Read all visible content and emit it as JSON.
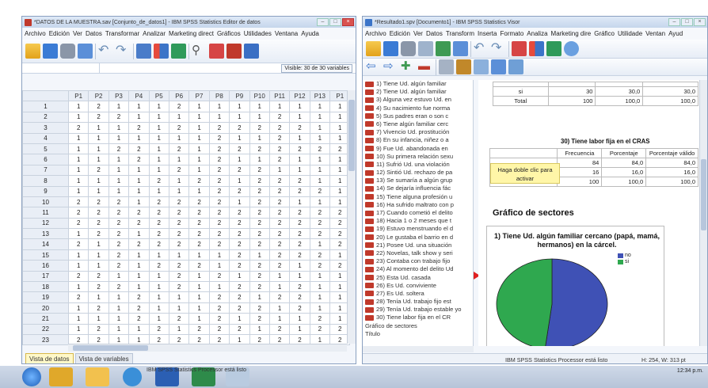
{
  "left_window": {
    "title": "*DATOS DE LA MUESTRA.sav [Conjunto_de_datos1] - IBM SPSS Statistics Editor de datos",
    "menu": [
      "Archivo",
      "Edición",
      "Ver",
      "Datos",
      "Transformar",
      "Analizar",
      "Marketing direct",
      "Gráficos",
      "Utilidades",
      "Ventana",
      "Ayuda"
    ],
    "visible_label": "Visible: 30 de 30 variables",
    "columns": [
      "P1",
      "P2",
      "P3",
      "P4",
      "P5",
      "P6",
      "P7",
      "P8",
      "P9",
      "P10",
      "P11",
      "P12",
      "P13",
      "P1"
    ],
    "rows": [
      [
        "1",
        "2",
        "1",
        "1",
        "1",
        "2",
        "1",
        "1",
        "1",
        "1",
        "1",
        "1",
        "1",
        "1"
      ],
      [
        "1",
        "2",
        "2",
        "1",
        "1",
        "1",
        "1",
        "1",
        "1",
        "1",
        "2",
        "1",
        "1",
        "1"
      ],
      [
        "2",
        "1",
        "1",
        "2",
        "1",
        "2",
        "1",
        "2",
        "2",
        "2",
        "2",
        "2",
        "1",
        "1"
      ],
      [
        "1",
        "1",
        "1",
        "1",
        "1",
        "1",
        "1",
        "2",
        "1",
        "1",
        "2",
        "1",
        "1",
        "1"
      ],
      [
        "1",
        "1",
        "2",
        "2",
        "1",
        "2",
        "1",
        "2",
        "2",
        "2",
        "2",
        "2",
        "2",
        "2"
      ],
      [
        "1",
        "1",
        "1",
        "2",
        "1",
        "1",
        "1",
        "2",
        "1",
        "1",
        "2",
        "1",
        "1",
        "1"
      ],
      [
        "1",
        "2",
        "1",
        "1",
        "1",
        "2",
        "1",
        "2",
        "2",
        "2",
        "1",
        "1",
        "1",
        "1"
      ],
      [
        "1",
        "1",
        "1",
        "1",
        "2",
        "1",
        "2",
        "2",
        "1",
        "2",
        "2",
        "2",
        "1",
        "1"
      ],
      [
        "1",
        "1",
        "1",
        "1",
        "1",
        "1",
        "1",
        "2",
        "2",
        "2",
        "2",
        "2",
        "2",
        "1"
      ],
      [
        "2",
        "2",
        "2",
        "1",
        "2",
        "2",
        "2",
        "2",
        "1",
        "2",
        "2",
        "1",
        "1",
        "1"
      ],
      [
        "2",
        "2",
        "2",
        "2",
        "2",
        "2",
        "2",
        "2",
        "2",
        "2",
        "2",
        "2",
        "2",
        "2"
      ],
      [
        "2",
        "2",
        "2",
        "2",
        "2",
        "2",
        "2",
        "2",
        "2",
        "2",
        "2",
        "2",
        "2",
        "2"
      ],
      [
        "1",
        "2",
        "2",
        "1",
        "2",
        "2",
        "2",
        "2",
        "2",
        "2",
        "2",
        "2",
        "2",
        "2"
      ],
      [
        "2",
        "1",
        "2",
        "2",
        "2",
        "2",
        "2",
        "2",
        "2",
        "2",
        "2",
        "2",
        "1",
        "2"
      ],
      [
        "1",
        "1",
        "2",
        "1",
        "1",
        "1",
        "1",
        "1",
        "2",
        "1",
        "2",
        "2",
        "2",
        "1"
      ],
      [
        "1",
        "1",
        "2",
        "1",
        "2",
        "2",
        "2",
        "1",
        "2",
        "2",
        "2",
        "1",
        "2",
        "2"
      ],
      [
        "2",
        "2",
        "1",
        "1",
        "1",
        "2",
        "1",
        "2",
        "1",
        "2",
        "1",
        "1",
        "1",
        "1"
      ],
      [
        "1",
        "2",
        "2",
        "1",
        "1",
        "2",
        "1",
        "1",
        "2",
        "2",
        "1",
        "2",
        "1",
        "1"
      ],
      [
        "2",
        "1",
        "1",
        "2",
        "1",
        "1",
        "1",
        "2",
        "2",
        "1",
        "2",
        "2",
        "1",
        "1"
      ],
      [
        "1",
        "2",
        "1",
        "2",
        "1",
        "1",
        "1",
        "2",
        "2",
        "2",
        "1",
        "2",
        "1",
        "1"
      ],
      [
        "1",
        "1",
        "1",
        "2",
        "1",
        "2",
        "1",
        "2",
        "1",
        "2",
        "1",
        "1",
        "2",
        "1"
      ],
      [
        "1",
        "2",
        "1",
        "1",
        "2",
        "1",
        "2",
        "2",
        "2",
        "1",
        "2",
        "1",
        "2",
        "2"
      ],
      [
        "2",
        "2",
        "1",
        "1",
        "2",
        "2",
        "2",
        "2",
        "1",
        "2",
        "2",
        "2",
        "1",
        "2"
      ]
    ],
    "tab_data": "Vista de datos",
    "tab_vars": "Vista de variables"
  },
  "right_window": {
    "title": "*Resultado1.spv [Documento1] - IBM SPSS Statistics Visor",
    "menu": [
      "Archivo",
      "Edición",
      "Ver",
      "Datos",
      "Transform",
      "Inserta",
      "Formato",
      "Analiza",
      "Marketing dire",
      "Gráfico",
      "Utilidade",
      "Ventan",
      "Ayud"
    ],
    "outline": [
      "1) Tiene Ud. algún familiar",
      "2) Tiene Ud. algún familiar",
      "3) Alguna vez estuvo Ud. en",
      "4) Su nacimiento fue norma",
      "5) Sus padres eran o son c",
      "6) Tiene algún familiar cerc",
      "7) Vivencio Ud. prostitución",
      "8) En su infancia, niñez o a",
      "9) Fue Ud. abandonada en",
      "10) Su primera relación sexu",
      "11) Sufrió Ud. una violación",
      "12) Sintió Ud. rechazo de pa",
      "13) Se sumaría a algún grup",
      "14) Se dejaría influencia fác",
      "15) Tiene alguna profesión u",
      "16) Ha sufrido maltrato con p",
      "17) Cuando cometió el delito",
      "18) Hacia 1 o 2 meses que t",
      "19) Estuvo menstruando el d",
      "20) Le gustaba el barrio en d",
      "21) Posee Ud. una situación",
      "22) Novelas, talk show y seri",
      "23) Contaba con trabajo fijo",
      "24) Al momento del delito Ud",
      "25) Esta Ud. casada",
      "26) Es Ud. conviviente",
      "27) Es Ud. soltera",
      "28) Tenía Ud. trabajo fijo est",
      "29) Tenía Ud. trabajo estable yo",
      "30) Tiene labor fija en el CR",
      "Gráfico de sectores",
      "Título"
    ],
    "top_table": {
      "rows": [
        {
          "label": "si",
          "freq": "30",
          "pct": "30,0",
          "valid": "30,0"
        },
        {
          "label": "Total",
          "freq": "100",
          "pct": "100,0",
          "valid": "100,0"
        }
      ]
    },
    "table30": {
      "title": "30) Tiene labor fija en el CRAS",
      "headers": [
        "Frecuencia",
        "Porcentaje",
        "Porcentaje válido"
      ],
      "rows": [
        {
          "freq": "84",
          "pct": "84,0",
          "valid": "84,0"
        },
        {
          "freq": "16",
          "pct": "16,0",
          "valid": "16,0"
        },
        {
          "label": "Total",
          "freq": "100",
          "pct": "100,0",
          "valid": "100,0"
        }
      ]
    },
    "tooltip": "Haga doble clic para activar",
    "section_title": "Gráfico de sectores",
    "status_processor": "IBM SPSS Statistics Processor está listo",
    "status_size": "H: 254, W: 313 pt"
  },
  "chart_data": {
    "type": "pie",
    "title": "1)  Tiene Ud. algún familiar cercano (papá, mamá, hermanos) en la cárcel.",
    "categories": [
      "no",
      "si"
    ],
    "values": [
      52,
      48
    ],
    "colors": [
      "#3f51b5",
      "#2fa84f"
    ],
    "legend": "top-right"
  },
  "taskbar": {
    "status": "IBM SPSS Statistics Processor está listo",
    "clock": "12:34 p.m."
  }
}
